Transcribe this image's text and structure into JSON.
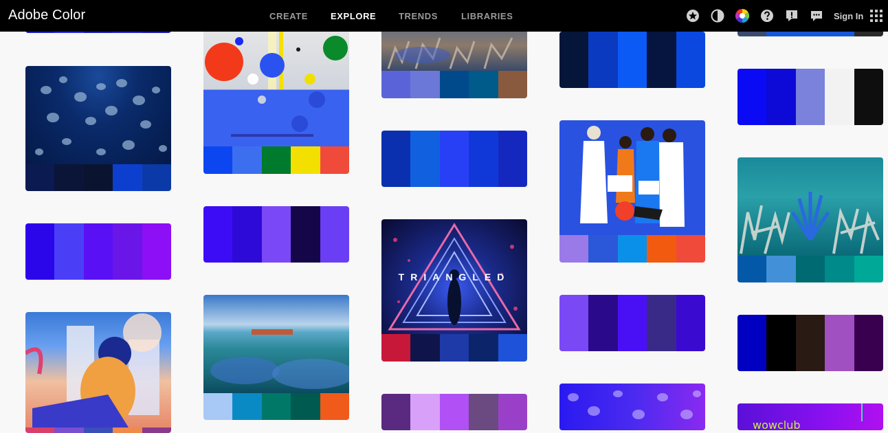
{
  "header": {
    "app_title": "Adobe Color",
    "nav": [
      {
        "label": "CREATE",
        "active": false
      },
      {
        "label": "EXPLORE",
        "active": true
      },
      {
        "label": "TRENDS",
        "active": false
      },
      {
        "label": "LIBRARIES",
        "active": false
      }
    ],
    "icons": [
      "star-icon",
      "contrast-icon",
      "color-wheel-icon",
      "help-icon",
      "alert-icon",
      "chat-icon"
    ],
    "sign_in": "Sign In",
    "apps_icon": "apps-grid-icon"
  },
  "overlay_text": {
    "triangled": "TRIANGLED",
    "wow": "wowclub"
  },
  "palettes": {
    "c1_top": [
      "#1a1fbf",
      "#2a2ae0",
      "#1b1bb5",
      "#2424c8",
      "#1a1ab0"
    ],
    "c1_jelly": [
      "#0c1a52",
      "#0b1538",
      "#0a1430",
      "#0d3fcf",
      "#0b3aa8"
    ],
    "c1_purple": [
      "#2c06ea",
      "#4a3ff7",
      "#5a10f5",
      "#6b16e8",
      "#8d0ff5"
    ],
    "c1_girl": [
      "#d8406a",
      "#7a4fd0",
      "#3b4fb8",
      "#ef8a4a",
      "#8a3a8a"
    ],
    "c2_balls": [
      "#0c46f0",
      "#3c6ef0",
      "#007a2c",
      "#f3e000",
      "#f04a3a"
    ],
    "c2_violet": [
      "#3d0cf7",
      "#2e0ad8",
      "#7a48f7",
      "#15064a",
      "#6a3ef5"
    ],
    "c2_reef": [
      "#a8c8f5",
      "#0a8ac4",
      "#007868",
      "#005a50",
      "#f05a1a"
    ],
    "c3_coral": [
      "#5a64d8",
      "#6b78d8",
      "#004a8c",
      "#005a8a",
      "#8a5a3e"
    ],
    "c3_blue": [
      "#0a30b0",
      "#1060e0",
      "#2840f5",
      "#1038d8",
      "#1428c0"
    ],
    "c3_triangled": [
      "#c8183a",
      "#0f154a",
      "#1d3aa8",
      "#0c246a",
      "#1e52d8"
    ],
    "c3_bottom": [
      "#5a2a80",
      "#d8a0f8",
      "#b050f5",
      "#6a4a80",
      "#9a40c8"
    ],
    "c4_top": [
      "#06153a",
      "#0a3ac0",
      "#0c5af5",
      "#061540",
      "#0a48e0"
    ],
    "c4_people": [
      "#9a7ae8",
      "#2a58d8",
      "#0a90e8",
      "#f25a10",
      "#f04a3a"
    ],
    "c4_purple": [
      "#7a48f5",
      "#2a0a8a",
      "#4a10f5",
      "#3a2a88",
      "#3a0ad0"
    ],
    "c5_top": [
      "#3a4a70",
      "#1858d8",
      "#1858d8",
      "#1858d8",
      "#2a2a2a"
    ],
    "c5_blue": [
      "#0b0af5",
      "#0d0ad8",
      "#7a82dc",
      "#f2f2f2",
      "#0e0e0e"
    ],
    "c5_coral": [
      "#0458a8",
      "#4190d8",
      "#006a72",
      "#008a8a",
      "#00a898"
    ],
    "c5_dark": [
      "#0000c0",
      "#000000",
      "#2a1a14",
      "#a050c0",
      "#3a0050"
    ]
  }
}
